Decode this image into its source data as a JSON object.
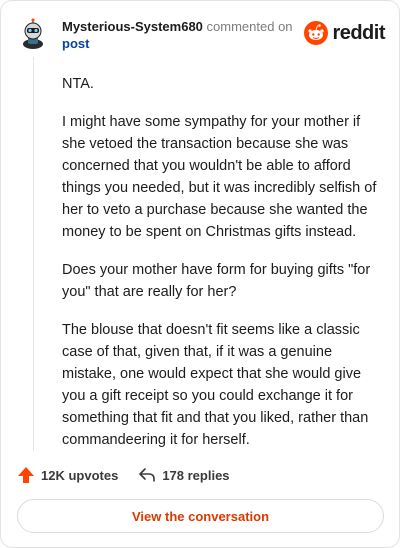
{
  "header": {
    "author": "Mysterious-System680",
    "commented_on": "commented on",
    "post_link": "post",
    "brand": "reddit"
  },
  "comment": {
    "paragraphs": [
      "NTA.",
      "I might have some sympathy for your mother if she vetoed the transaction because she was concerned that you wouldn't be able to afford things you needed, but it was incredibly selfish of her to veto a purchase because she wanted the money to be spent on Christmas gifts instead.",
      "Does your mother have form for buying gifts \"for you\" that are really for her?",
      "The blouse that doesn't fit seems like a classic case of that, given that, if it was a genuine mistake, one would expect that she would give you a gift receipt so you could exchange it for something that fit and that you liked, rather than commandeering it for herself."
    ]
  },
  "actions": {
    "upvotes": "12K upvotes",
    "replies": "178 replies"
  },
  "cta": {
    "label": "View the conversation"
  },
  "colors": {
    "brand": "#ff4500",
    "link": "#0a449b",
    "cta_text": "#d93a00"
  },
  "icons": [
    "avatar",
    "reddit-logo-icon",
    "upvote-arrow-icon",
    "reply-icon"
  ]
}
